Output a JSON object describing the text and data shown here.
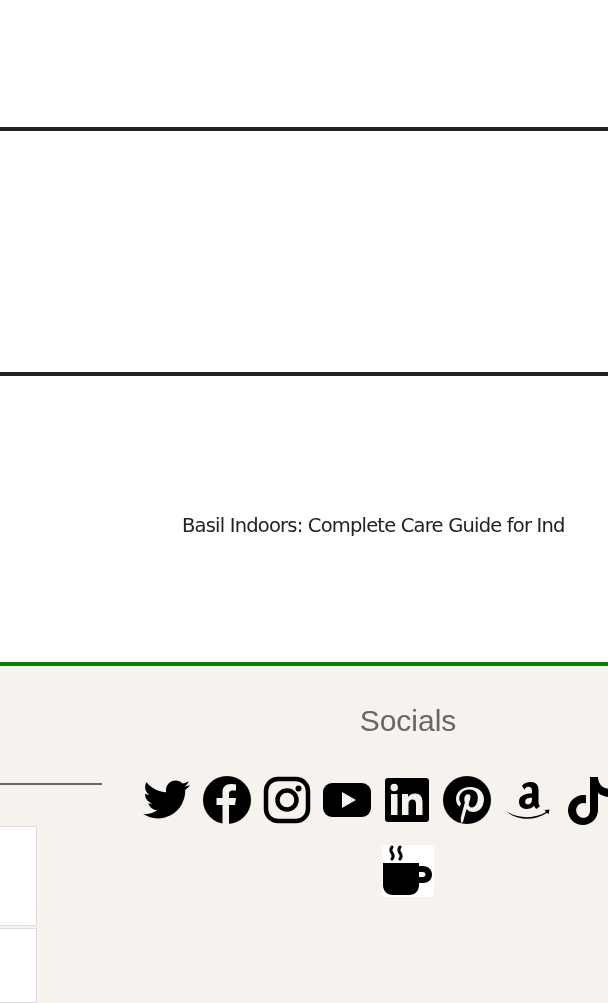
{
  "article_link": "Basil Indoors: Complete Care Guide for Ind",
  "footer": {
    "socials_title": "Socials",
    "links": [
      {
        "kind": "twitter"
      },
      {
        "kind": "facebook"
      },
      {
        "kind": "instagram"
      },
      {
        "kind": "youtube"
      },
      {
        "kind": "linkedin"
      },
      {
        "kind": "pinterest"
      },
      {
        "kind": "amazon"
      },
      {
        "kind": "tiktok"
      },
      {
        "kind": "coffee"
      }
    ]
  }
}
